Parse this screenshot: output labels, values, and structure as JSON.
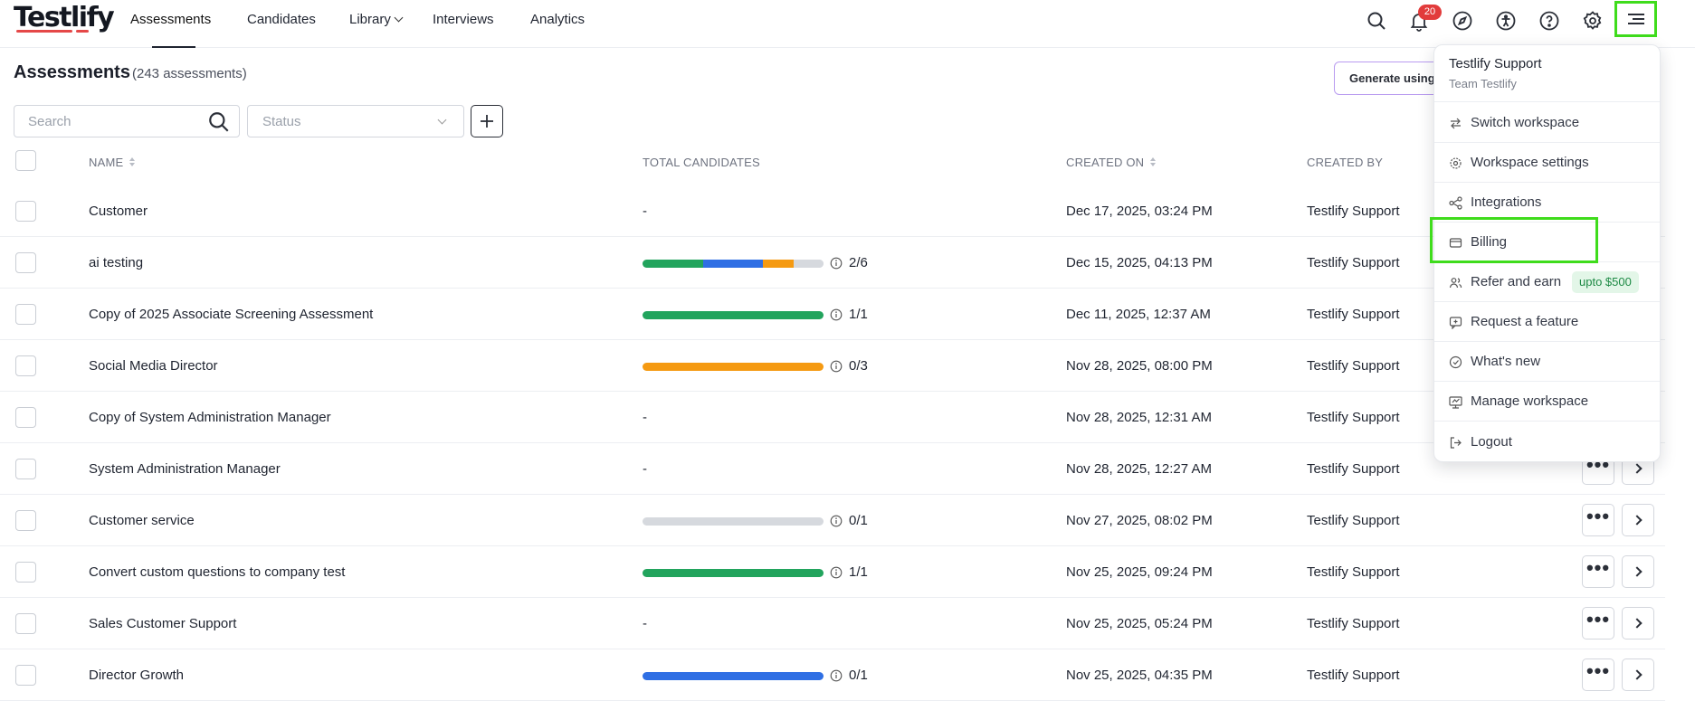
{
  "brand": {
    "logo": "Testlify",
    "accent": "#e54848",
    "highlight": "#3fdc1c"
  },
  "nav": {
    "tabs": [
      {
        "label": "Assessments",
        "active": true
      },
      {
        "label": "Candidates"
      },
      {
        "label": "Library"
      },
      {
        "label": "Interviews"
      },
      {
        "label": "Analytics"
      }
    ],
    "icons": [
      "search-icon",
      "bell-icon",
      "compass-icon",
      "accessibility-icon",
      "help-icon",
      "gear-icon",
      "menu-icon"
    ],
    "notification_count": "20"
  },
  "page": {
    "title": "Assessments",
    "count": "(243 assessments)",
    "generate_button": "Generate using AI"
  },
  "filters": {
    "search_placeholder": "Search",
    "status_placeholder": "Status"
  },
  "table": {
    "columns": {
      "name": "NAME",
      "total_candidates": "TOTAL CANDIDATES",
      "created_on": "CREATED ON",
      "created_by": "CREATED BY"
    },
    "rows": [
      {
        "name": "Customer",
        "candidates": "-",
        "created_on": "Dec 17, 2025, 03:24 PM",
        "created_by": "Testlify Support"
      },
      {
        "name": "ai testing",
        "ratio": "2/6",
        "progress": [
          {
            "color": "#22a45d",
            "value": 2
          },
          {
            "color": "#2f6fe4",
            "value": 2
          },
          {
            "color": "#f59a12",
            "value": 1
          },
          {
            "color": "#d6d9de",
            "value": 1
          }
        ],
        "created_on": "Dec 15, 2025, 04:13 PM",
        "created_by": "Testlify Support"
      },
      {
        "name": "Copy of 2025 Associate Screening Assessment",
        "ratio": "1/1",
        "progress": [
          {
            "color": "#22a45d",
            "value": 1
          }
        ],
        "created_on": "Dec 11, 2025, 12:37 AM",
        "created_by": "Testlify Support"
      },
      {
        "name": "Social Media Director",
        "ratio": "0/3",
        "progress": [
          {
            "color": "#f59a12",
            "value": 3
          }
        ],
        "created_on": "Nov 28, 2025, 08:00 PM",
        "created_by": "Testlify Support"
      },
      {
        "name": "Copy of System Administration Manager",
        "candidates": "-",
        "created_on": "Nov 28, 2025, 12:31 AM",
        "created_by": "Testlify Support"
      },
      {
        "name": "System Administration Manager",
        "candidates": "-",
        "created_on": "Nov 28, 2025, 12:27 AM",
        "created_by": "Testlify Support"
      },
      {
        "name": "Customer service",
        "ratio": "0/1",
        "progress": [
          {
            "color": "#d6d9de",
            "value": 1
          }
        ],
        "created_on": "Nov 27, 2025, 08:02 PM",
        "created_by": "Testlify Support"
      },
      {
        "name": "Convert custom questions to company test",
        "ratio": "1/1",
        "progress": [
          {
            "color": "#22a45d",
            "value": 1
          }
        ],
        "created_on": "Nov 25, 2025, 09:24 PM",
        "created_by": "Testlify Support"
      },
      {
        "name": "Sales Customer Support",
        "candidates": "-",
        "created_on": "Nov 25, 2025, 05:24 PM",
        "created_by": "Testlify Support"
      },
      {
        "name": "Director Growth",
        "ratio": "0/1",
        "progress": [
          {
            "color": "#2f6fe4",
            "value": 1
          }
        ],
        "created_on": "Nov 25, 2025, 04:35 PM",
        "created_by": "Testlify Support"
      }
    ]
  },
  "menu": {
    "user": "Testlify Support",
    "team": "Team Testlify",
    "items": [
      {
        "label": "Switch workspace",
        "icon": "switch-icon"
      },
      {
        "label": "Workspace settings",
        "icon": "gear-icon"
      },
      {
        "label": "Integrations",
        "icon": "integrations-icon"
      },
      {
        "label": "Billing",
        "icon": "billing-icon"
      },
      {
        "label": "Refer and earn",
        "icon": "users-icon",
        "badge": "upto $500"
      },
      {
        "label": "Request a feature",
        "icon": "request-icon"
      },
      {
        "label": "What's new",
        "icon": "new-icon"
      },
      {
        "label": "Manage workspace",
        "icon": "manage-icon"
      },
      {
        "label": "Logout",
        "icon": "logout-icon"
      }
    ]
  }
}
